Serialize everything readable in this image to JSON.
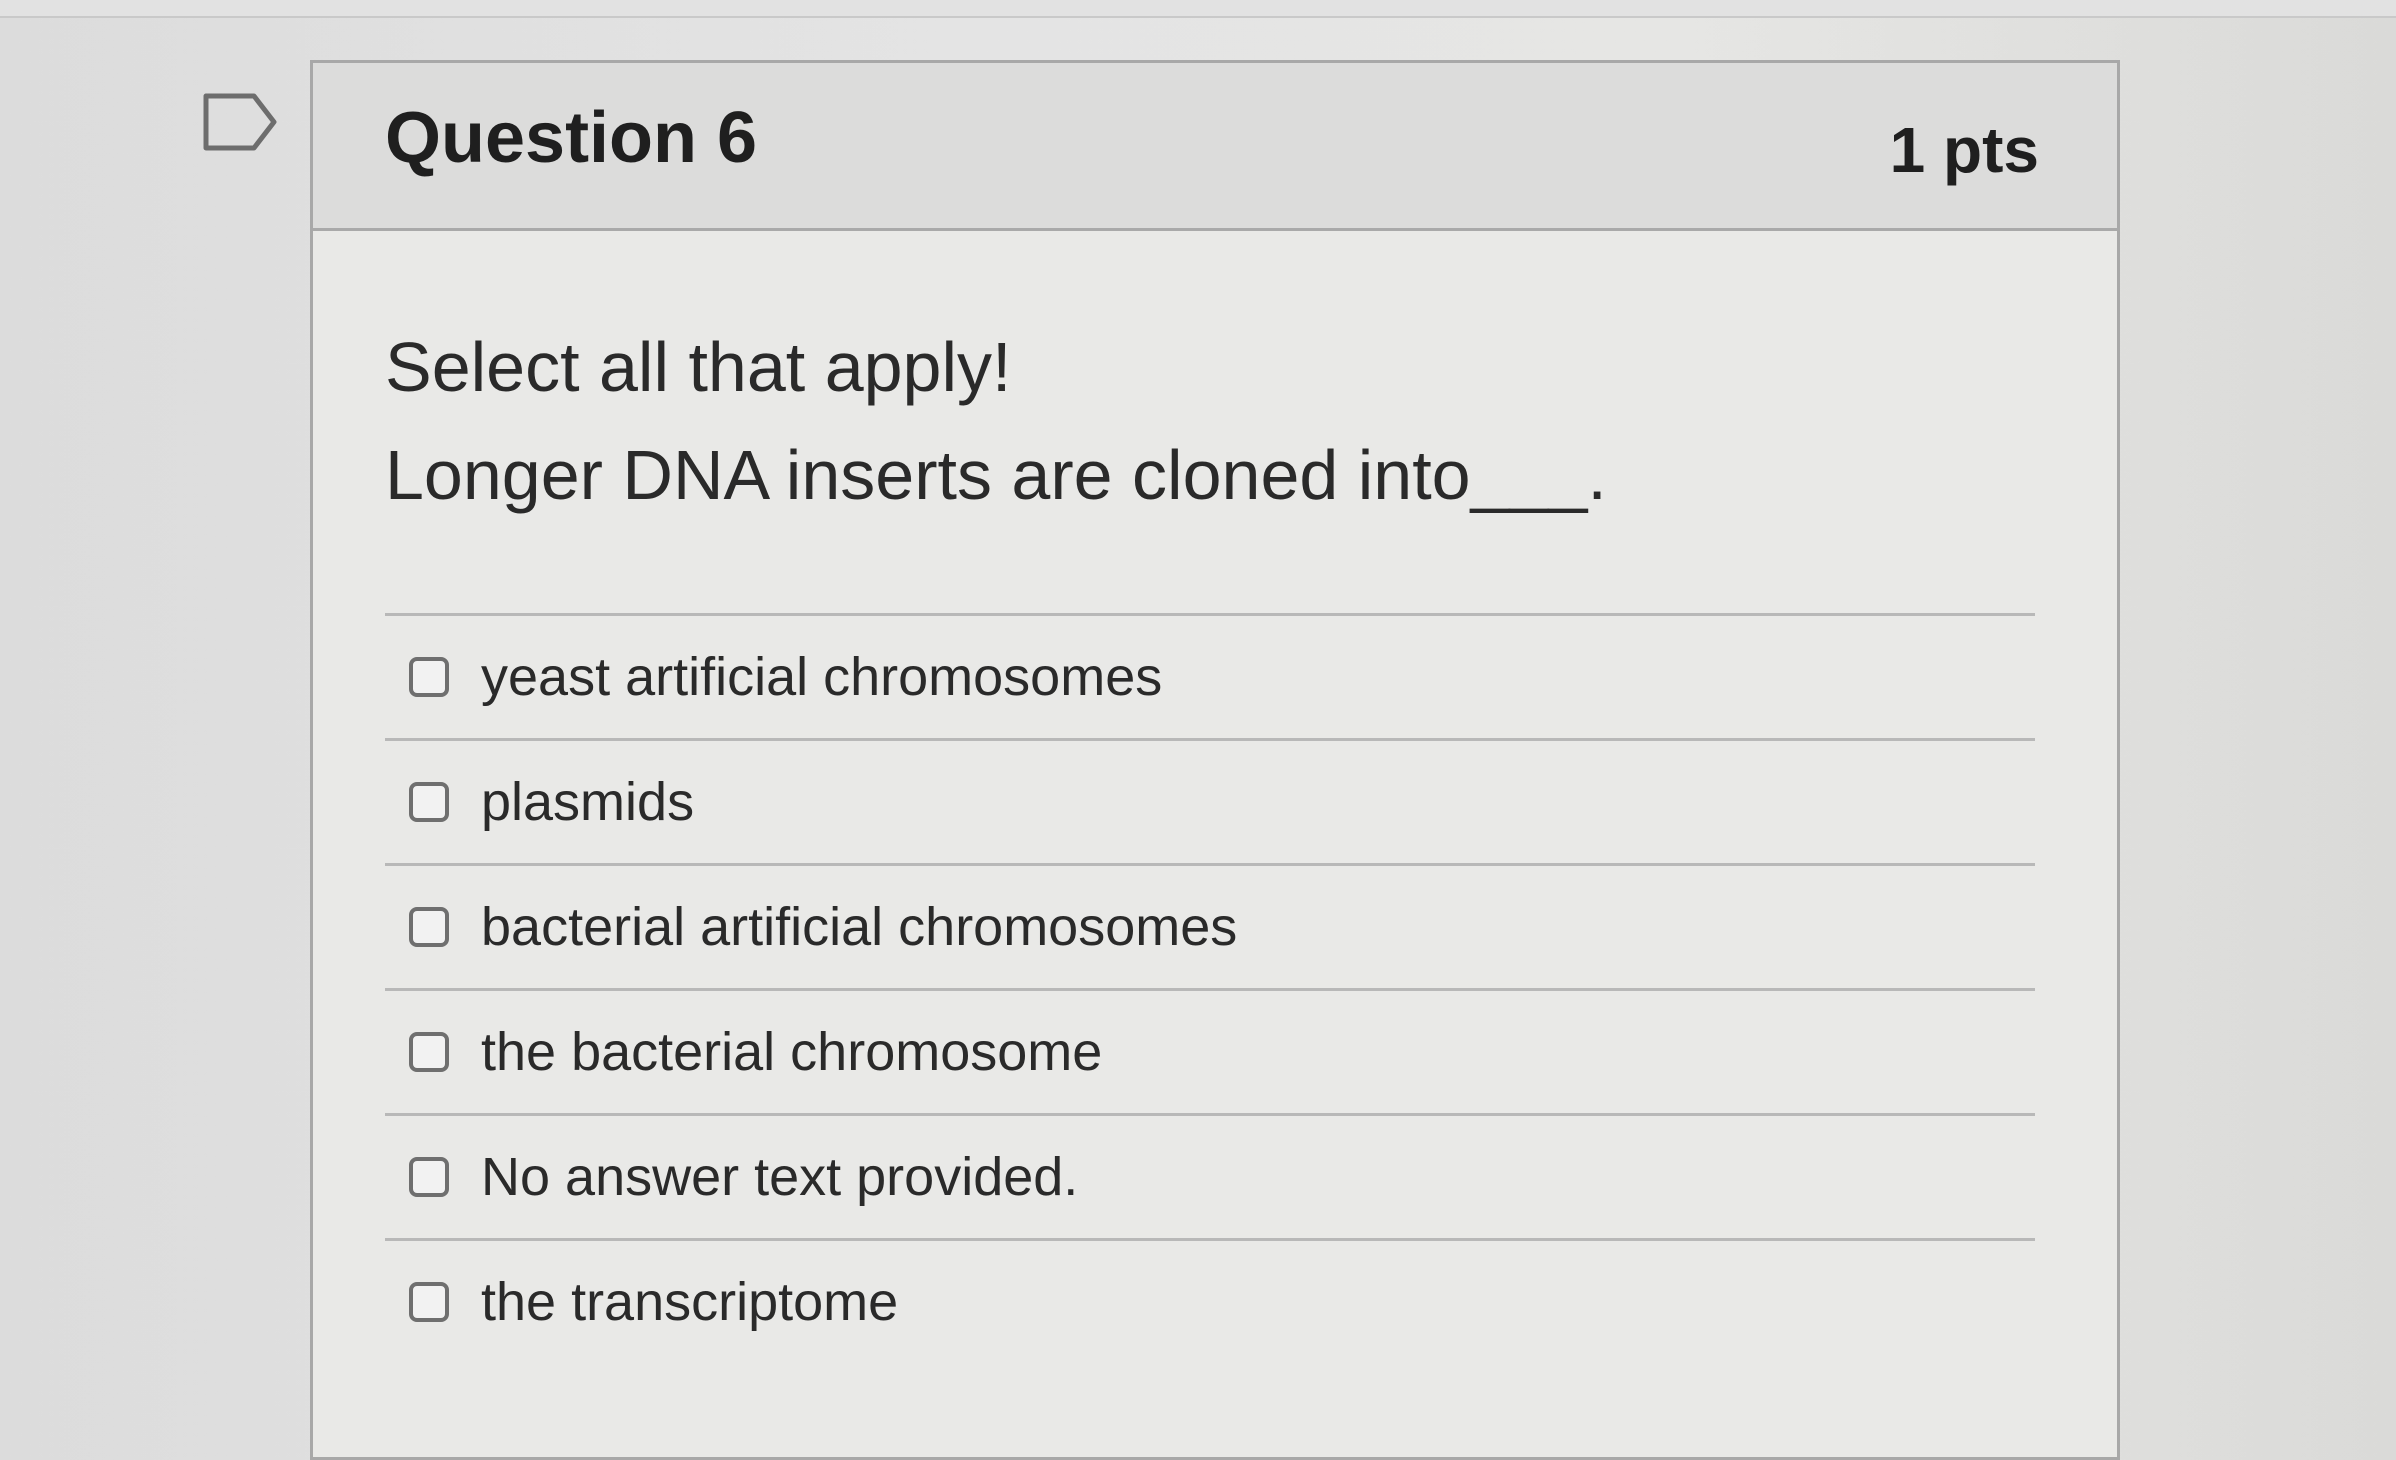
{
  "question": {
    "title": "Question 6",
    "points": "1 pts",
    "instruction": "Select all that apply!",
    "prompt": "Longer DNA inserts are cloned into___."
  },
  "answers": [
    {
      "label": "yeast artificial chromosomes"
    },
    {
      "label": "plasmids"
    },
    {
      "label": "bacterial artificial chromosomes"
    },
    {
      "label": "the bacterial chromosome"
    },
    {
      "label": "No answer text provided."
    },
    {
      "label": "the transcriptome"
    }
  ],
  "icons": {
    "flag": "flag-icon"
  }
}
